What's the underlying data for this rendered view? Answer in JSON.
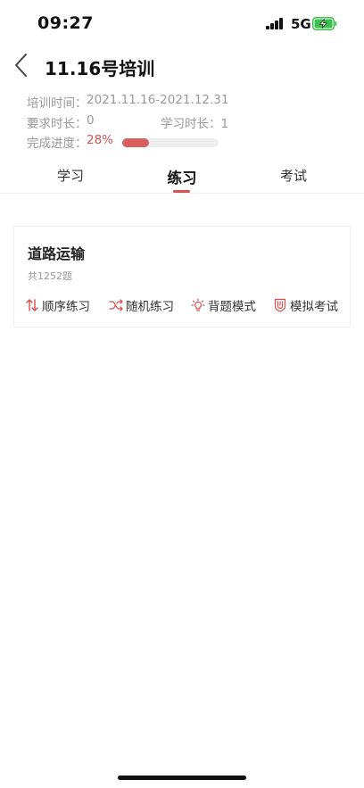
{
  "status_bar": {
    "time": "09:27",
    "network": "5G"
  },
  "header": {
    "title": "11.16号培训"
  },
  "info": {
    "training_time_label": "培训时间：",
    "training_time_value": "2021.11.16-2021.12.31",
    "required_label": "要求时长：",
    "required_value": "0",
    "studied_label": "学习时长：",
    "studied_value": "1",
    "progress_label": "完成进度：",
    "progress_value": "28%",
    "progress_fraction": 0.28
  },
  "tabs": [
    {
      "label": "学习"
    },
    {
      "label": "练习",
      "active": true
    },
    {
      "label": "考试"
    }
  ],
  "card": {
    "title": "道路运输",
    "count": "共1252题",
    "actions": [
      {
        "label": "顺序练习",
        "icon": "sequence-icon"
      },
      {
        "label": "随机练习",
        "icon": "shuffle-icon"
      },
      {
        "label": "背题模式",
        "icon": "bulb-icon"
      },
      {
        "label": "模拟考试",
        "icon": "exam-shield-icon"
      }
    ]
  },
  "colors": {
    "accent": "#d94f4f",
    "text": "#222222",
    "muted": "#999999"
  }
}
